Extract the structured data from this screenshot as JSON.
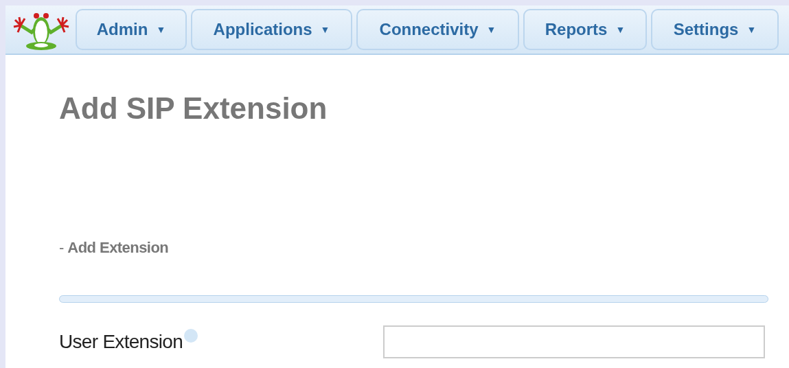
{
  "menu": [
    {
      "label": "Admin",
      "caret": "▼"
    },
    {
      "label": "Applications",
      "caret": "▼"
    },
    {
      "label": "Connectivity",
      "caret": "▼"
    },
    {
      "label": "Reports",
      "caret": "▼"
    },
    {
      "label": "Settings",
      "caret": "▼"
    }
  ],
  "page_title": "Add SIP Extension",
  "section": {
    "title": "- **Add Extension**"
  },
  "fields": [
    {
      "label": "User Extension",
      "help": true
    }
  ]
}
